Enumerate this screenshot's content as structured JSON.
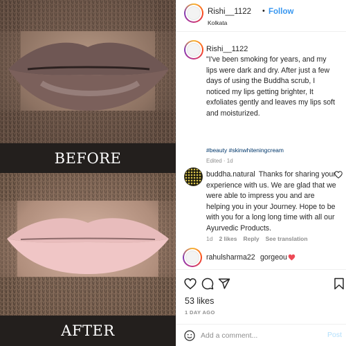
{
  "photo": {
    "before_label": "BEFORE",
    "after_label": "AFTER"
  },
  "post": {
    "username": "Rishi__1122",
    "separator": "•",
    "follow_label": "Follow",
    "location": "Kolkata"
  },
  "caption": {
    "username": "Rishi__1122",
    "text": "\"I've been smoking for years, and my lips were dark and dry. After just a few days of using the Buddha scrub, I noticed my lips getting brighter, It exfoliates gently and leaves my lips soft and moisturized.",
    "tags": "#beauty #skinwhiteningcream",
    "edited": "Edited · 1d"
  },
  "comments": [
    {
      "username": "buddha.natural",
      "text": "Thanks for sharing your experience with us. We are glad that we were able to impress you and are helping you in your Journey. Hope to be with you for a long long time with all our Ayurvedic Products.",
      "meta": {
        "age": "1d",
        "likes": "2 likes",
        "reply": "Reply",
        "translate": "See translation"
      }
    },
    {
      "username": "rahulsharma22",
      "text": "gorgeou"
    }
  ],
  "actions": {
    "likes": "53 likes",
    "time_ago": "1 DAY AGO"
  },
  "add_comment": {
    "placeholder": "Add a comment...",
    "post_label": "Post"
  },
  "colors": {
    "accent": "#3897f0",
    "heart": "#ed4956",
    "post_disabled": "#b2dffc",
    "label_band": "#231f1d"
  },
  "icons": [
    "heart-icon",
    "comment-icon",
    "share-icon",
    "bookmark-icon",
    "emoji-icon"
  ]
}
